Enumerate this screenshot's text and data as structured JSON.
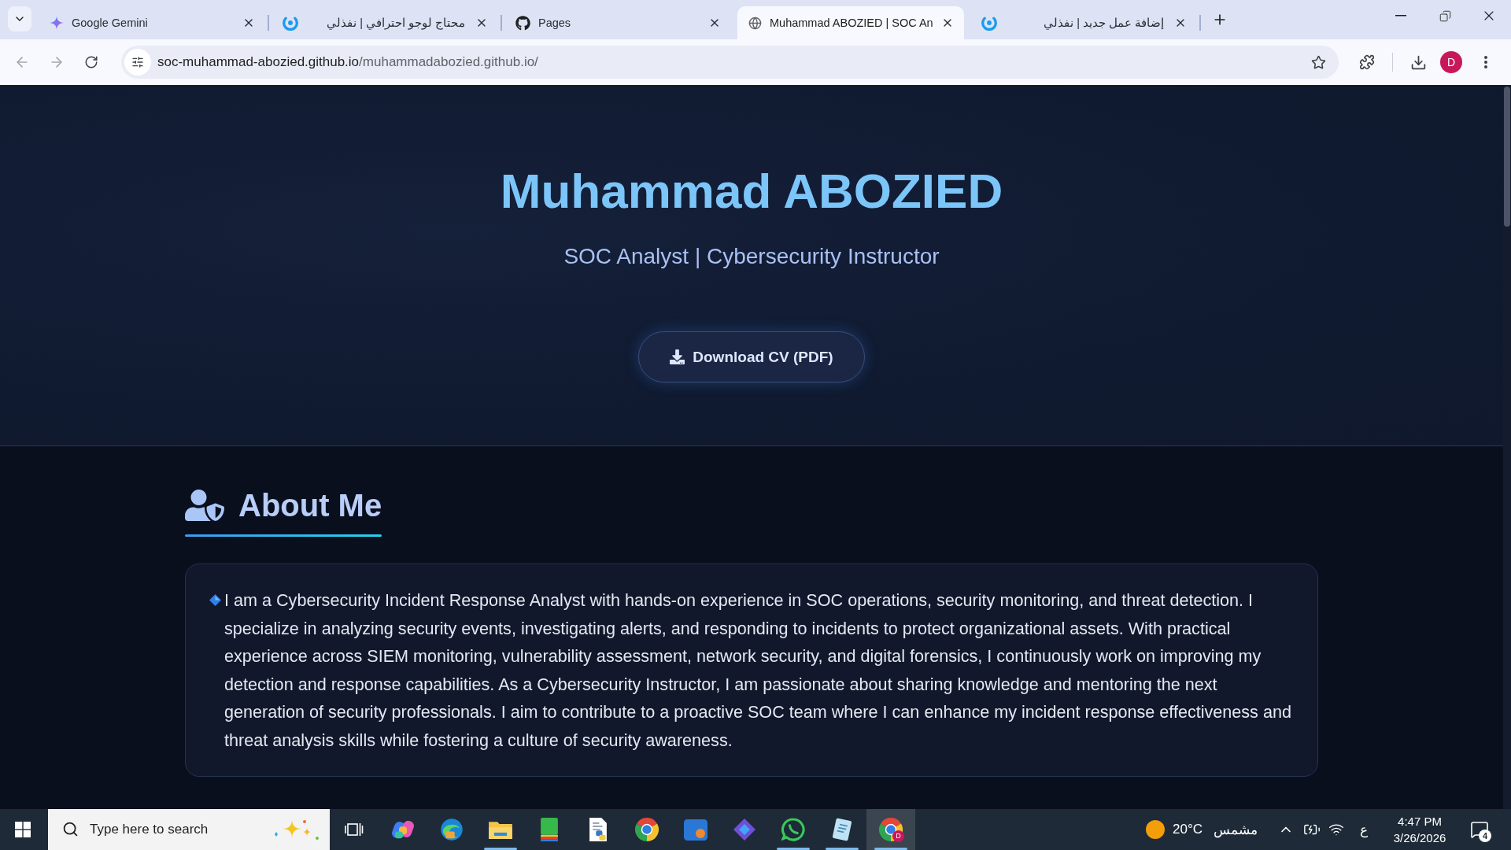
{
  "browser": {
    "tabs": [
      {
        "title": "Google Gemini",
        "kind": "sparkle",
        "selected": false
      },
      {
        "title": "محتاج لوجو احترافي | نفذلي",
        "kind": "ring",
        "selected": false
      },
      {
        "title": "Pages",
        "kind": "cat",
        "selected": false
      },
      {
        "title": "Muhammad ABOZIED | SOC An",
        "kind": "globe",
        "selected": true
      },
      {
        "title": "إضافة عمل جديد | نفذلي",
        "kind": "ring",
        "selected": false
      }
    ],
    "navigation": {
      "back": {
        "disabled": true
      },
      "forward": {
        "disabled": true
      }
    },
    "address": {
      "host": "soc-muhammad-abozied.github.io",
      "path": "/muhammadabozied.github.io/"
    },
    "profile": "D"
  },
  "hero": {
    "name": "Muhammad ABOZIED",
    "tagline": "SOC Analyst | Cybersecurity Instructor",
    "button": "Download CV (PDF)"
  },
  "about": {
    "heading": "About Me",
    "paragraph": "I am a Cybersecurity Incident Response Analyst with hands-on experience in SOC operations, security monitoring, and threat detection. I specialize in analyzing security events, investigating alerts, and responding to incidents to protect organizational assets. With practical experience across SIEM monitoring, vulnerability assessment, network security, and digital forensics, I continuously work on improving my detection and response capabilities. As a Cybersecurity Instructor, I am passionate about sharing knowledge and mentoring the next generation of security professionals. I aim to contribute to a proactive SOC team where I can enhance my incident response effectiveness and threat analysis skills while fostering a culture of security awareness."
  },
  "taskbar": {
    "search": {
      "placeholder": "Type here to search"
    },
    "apps": [
      {
        "kind": "task-view",
        "running": false,
        "active": false
      },
      {
        "kind": "swirl",
        "running": false,
        "active": false
      },
      {
        "kind": "wave",
        "running": false,
        "active": false
      },
      {
        "kind": "folder",
        "running": true,
        "active": false
      },
      {
        "kind": "book",
        "running": false,
        "active": false
      },
      {
        "kind": "document",
        "running": false,
        "active": false
      },
      {
        "kind": "circle",
        "running": false,
        "active": false
      },
      {
        "kind": "tile",
        "running": false,
        "active": false
      },
      {
        "kind": "diamond",
        "running": false,
        "active": false
      },
      {
        "kind": "chat",
        "running": true,
        "active": false
      },
      {
        "kind": "notepad",
        "running": true,
        "active": false
      },
      {
        "kind": "circle",
        "running": true,
        "active": true,
        "badge": "D"
      }
    ],
    "weather": {
      "temperature": "20°C",
      "condition": "مشمس"
    },
    "language": "ع",
    "time": "4:47 PM",
    "date": "3/26/2026",
    "notifications": "4"
  }
}
